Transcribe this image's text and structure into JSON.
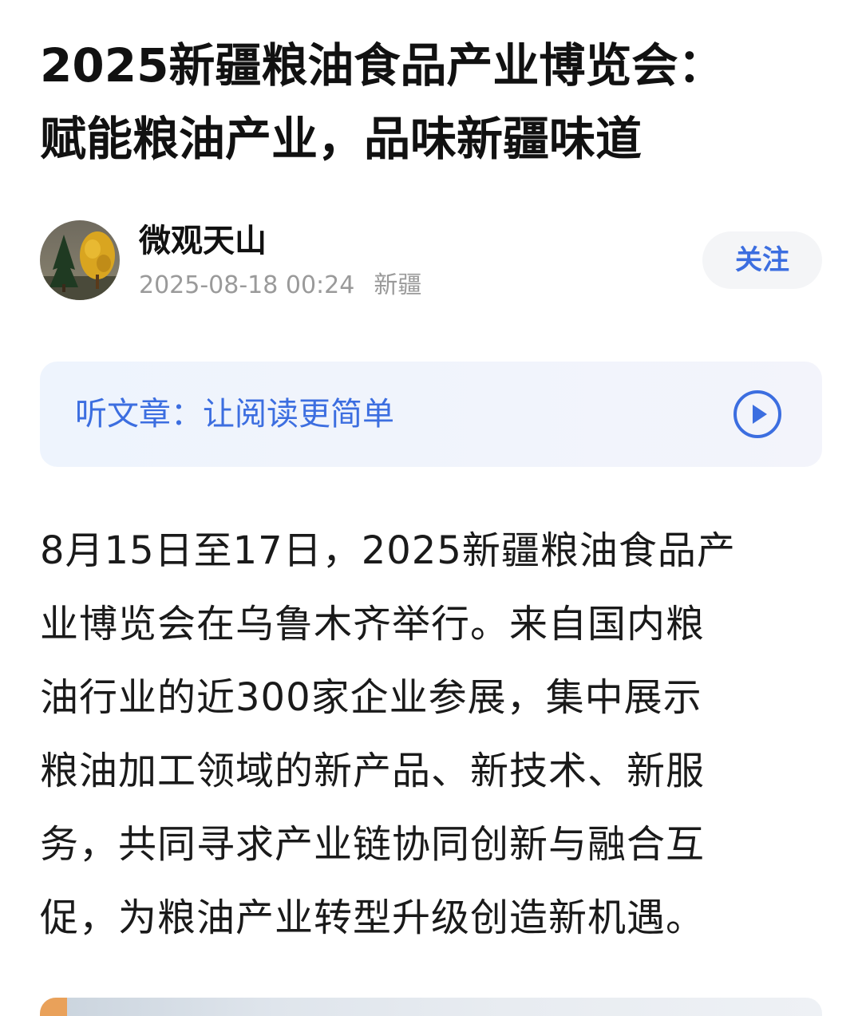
{
  "article": {
    "title_lines": [
      "2025新疆粮油食品产业博览会：",
      "赋能粮油产业，品味新疆味道"
    ]
  },
  "author": {
    "name": "微观天山",
    "date": "2025-08-18 00:24",
    "location": "新疆",
    "avatar_icon": "tree-landscape-avatar",
    "follow_label": "关注"
  },
  "listen": {
    "label": "听文章：让阅读更简单",
    "icon": "play-circle-icon"
  },
  "body": {
    "lines": [
      "8月15日至17日，2025新疆粮油食品产",
      "业博览会在乌鲁木齐举行。来自国内粮",
      "油行业的近300家企业参展，集中展示",
      "粮油加工领域的新产品、新技术、新服",
      "务，共同寻求产业链协同创新与融合互",
      "促，为粮油产业转型升级创造新机遇。"
    ]
  },
  "colors": {
    "accent": "#3c6ee0",
    "meta_gray": "#9a9a9a",
    "listen_bg": "#eef4fd",
    "follow_bg": "#f4f5f7"
  }
}
